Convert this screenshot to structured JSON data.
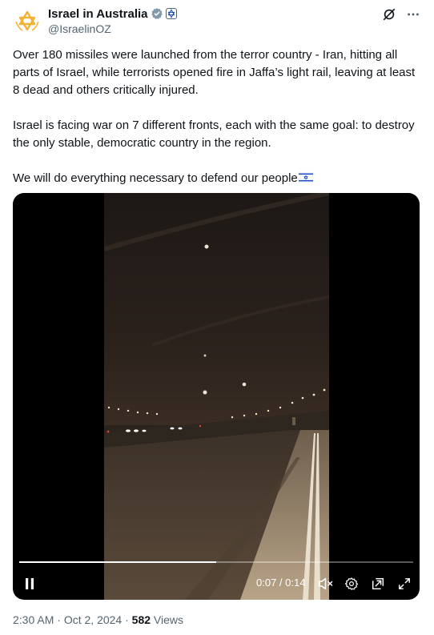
{
  "author": {
    "display_name": "Israel in Australia",
    "handle": "@IsraelinOZ"
  },
  "tweet": {
    "paragraph_1": "Over 180 missiles were launched from the terror country - Iran, hitting all parts of Israel, while terrorists opened fire in Jaffa’s light rail, leaving at least 8 dead and others critically injured.",
    "paragraph_2": "Israel is facing war on 7 different fronts, each with the same goal: to destroy the only stable, democratic country in the region.",
    "paragraph_3": "We will do everything necessary to defend our people"
  },
  "video": {
    "time_display": "0:07 / 0:14",
    "progress": 0.5
  },
  "meta": {
    "time": "2:30 AM",
    "separator": "·",
    "date": "Oct 2, 2024",
    "views_count": "582",
    "views_label": "Views"
  },
  "colors": {
    "accent": "#1d9bf0",
    "gold": "#f2b233",
    "text": "#0f1419",
    "muted": "#536471"
  }
}
